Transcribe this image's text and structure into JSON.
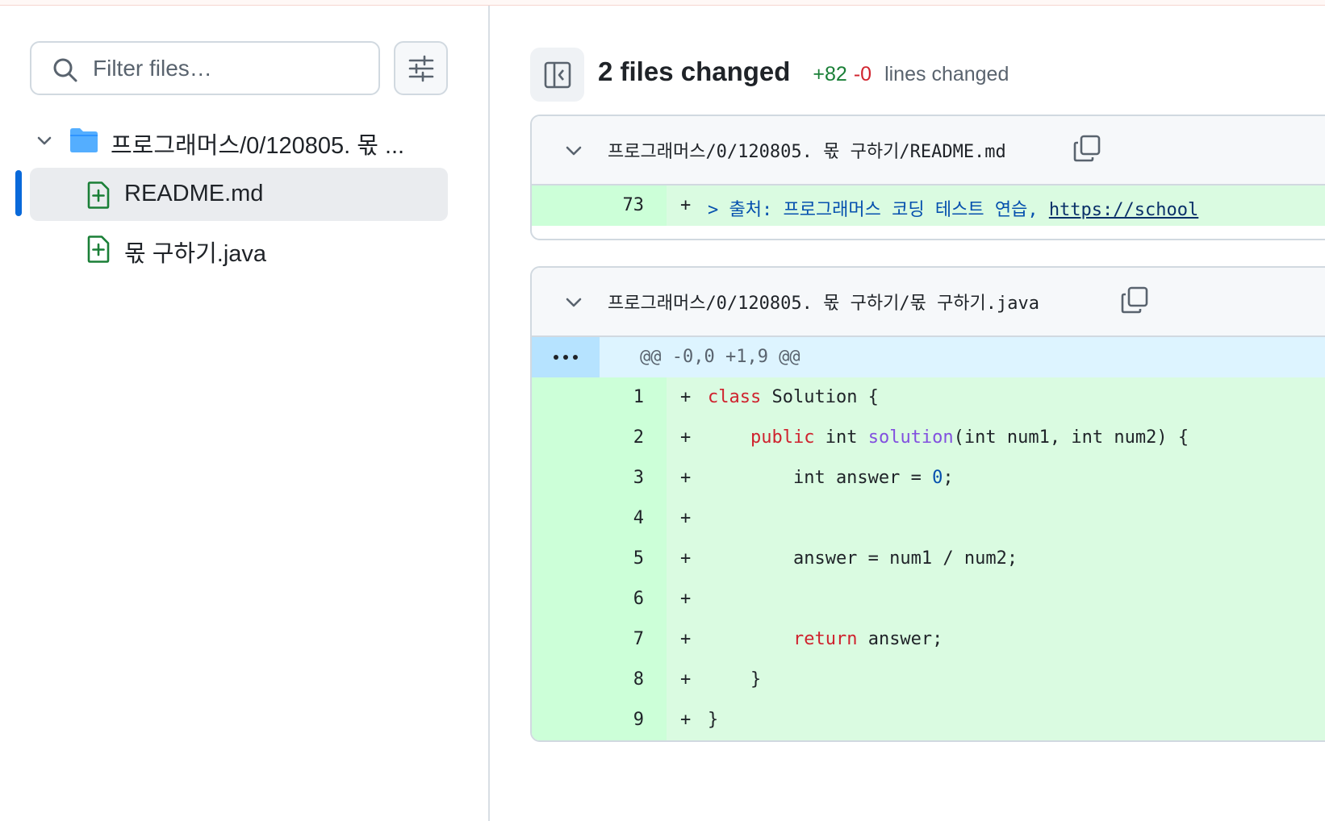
{
  "sidebar": {
    "filter_placeholder": "Filter files…",
    "folder": {
      "label": "프로그래머스/0/120805. 몫 ..."
    },
    "files": [
      {
        "label": "README.md",
        "status": "added",
        "active": true
      },
      {
        "label": "몫 구하기.java",
        "status": "added",
        "active": false
      }
    ]
  },
  "summary": {
    "files_changed": "2 files changed",
    "additions": "+82",
    "deletions": "-0",
    "lines_changed_label": "lines changed"
  },
  "diffs": [
    {
      "path": "프로그래머스/0/120805. 몫 구하기/README.md",
      "lines": [
        {
          "num": "73",
          "sign": "+",
          "text_prefix": "> 출처: 프로그래머스 코딩 테스트 연습, ",
          "link": "https://school"
        }
      ]
    },
    {
      "path": "프로그래머스/0/120805. 몫 구하기/몫 구하기.java",
      "hunk": "@@ -0,0 +1,9 @@",
      "lines": [
        {
          "num": "1",
          "sign": "+"
        },
        {
          "num": "2",
          "sign": "+"
        },
        {
          "num": "3",
          "sign": "+"
        },
        {
          "num": "4",
          "sign": "+"
        },
        {
          "num": "5",
          "sign": "+"
        },
        {
          "num": "6",
          "sign": "+"
        },
        {
          "num": "7",
          "sign": "+"
        },
        {
          "num": "8",
          "sign": "+"
        },
        {
          "num": "9",
          "sign": "+"
        }
      ],
      "code": {
        "l1_kw": "class",
        "l1_rest": " Solution {",
        "l2_indent": "    ",
        "l2_kw": "public",
        "l2_a": " int ",
        "l2_fn": "solution",
        "l2_b": "(int num1, int num2) {",
        "l3_a": "        int answer = ",
        "l3_num": "0",
        "l3_b": ";",
        "l4": "",
        "l5": "        answer = num1 / num2;",
        "l6": "",
        "l7_indent": "        ",
        "l7_kw": "return",
        "l7_rest": " answer;",
        "l8": "    }",
        "l9": "}"
      }
    }
  ],
  "colors": {
    "accent": "#0969da",
    "addition": "#1a7f37",
    "deletion": "#d1242f",
    "added_bg": "#dafbe1",
    "added_num_bg": "#ccffd8",
    "hunk_bg": "#ddf4ff"
  },
  "icons": [
    "search-icon",
    "sliders-icon",
    "chevron-down-icon",
    "folder-icon",
    "file-added-icon",
    "sidebar-collapse-icon",
    "copy-icon",
    "kebab-horizontal-icon"
  ]
}
